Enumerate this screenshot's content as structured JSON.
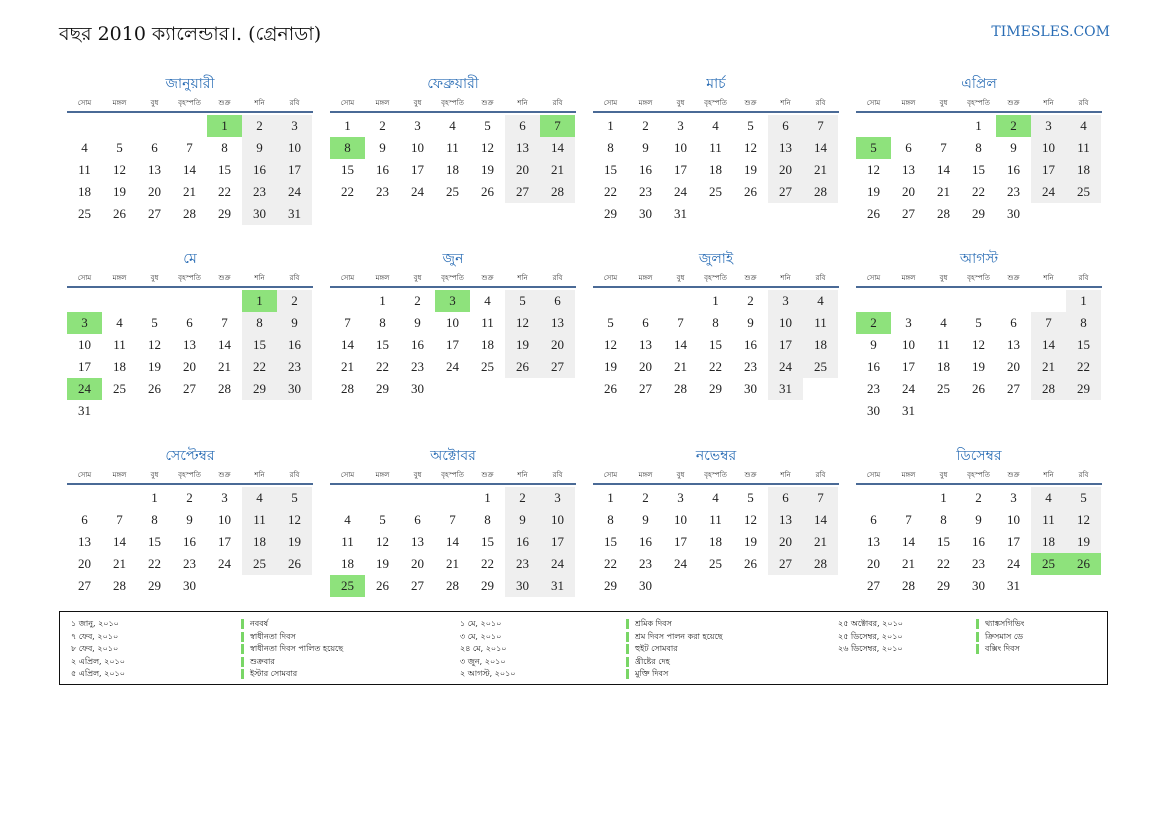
{
  "header": {
    "title": "বছর 2010 ক্যালেন্ডার।. (গ্রেনাডা)",
    "site": "TIMESLES.COM"
  },
  "weekdays": [
    "সোম",
    "মঙ্গল",
    "বুধ",
    "বৃহস্পতি",
    "শুক্র",
    "শনি",
    "রবি"
  ],
  "months": [
    {
      "name": "জানুয়ারী",
      "offset": 4,
      "days": 31,
      "holidays": [
        1
      ]
    },
    {
      "name": "ফেব্রুয়ারী",
      "offset": 0,
      "days": 28,
      "holidays": [
        7,
        8
      ]
    },
    {
      "name": "মার্চ",
      "offset": 0,
      "days": 31,
      "holidays": []
    },
    {
      "name": "এপ্রিল",
      "offset": 3,
      "days": 30,
      "holidays": [
        2,
        5
      ]
    },
    {
      "name": "মে",
      "offset": 5,
      "days": 31,
      "holidays": [
        1,
        3,
        24
      ]
    },
    {
      "name": "জুন",
      "offset": 1,
      "days": 30,
      "holidays": [
        3
      ]
    },
    {
      "name": "জুলাই",
      "offset": 3,
      "days": 31,
      "holidays": []
    },
    {
      "name": "আগস্ট",
      "offset": 6,
      "days": 31,
      "holidays": [
        2
      ]
    },
    {
      "name": "সেপ্টেম্বর",
      "offset": 2,
      "days": 30,
      "holidays": []
    },
    {
      "name": "অক্টোবর",
      "offset": 4,
      "days": 31,
      "holidays": [
        25
      ]
    },
    {
      "name": "নভেম্বর",
      "offset": 0,
      "days": 30,
      "holidays": []
    },
    {
      "name": "ডিসেম্বর",
      "offset": 2,
      "days": 31,
      "holidays": [
        25,
        26
      ]
    }
  ],
  "holidays": [
    {
      "date": "১ জানু, ২০১০",
      "name": "নববর্ষ"
    },
    {
      "date": "৭ ফেব, ২০১০",
      "name": "স্বাধীনতা দিবস"
    },
    {
      "date": "৮ ফেব, ২০১০",
      "name": "স্বাধীনতা দিবস পালিত হয়েছে"
    },
    {
      "date": "২ এপ্রিল, ২০১০",
      "name": "শুক্রবার"
    },
    {
      "date": "৫ এপ্রিল, ২০১০",
      "name": "ইস্টার সোমবার"
    },
    {
      "date": "১ মে, ২০১০",
      "name": "শ্রমিক দিবস"
    },
    {
      "date": "৩ মে, ২০১০",
      "name": "শ্রম দিবস পালন করা হয়েছে"
    },
    {
      "date": "২৪ মে, ২০১০",
      "name": "হুইট সোমবার"
    },
    {
      "date": "৩ জুন, ২০১০",
      "name": "খ্রীষ্টের দেহ"
    },
    {
      "date": "২ আগস্ট, ২০১০",
      "name": "মুক্তি দিবস"
    },
    {
      "date": "২৫ অক্টোবর, ২০১০",
      "name": "থ্যাঙ্কসগিভিং"
    },
    {
      "date": "২৫ ডিসেম্বর, ২০১০",
      "name": "ক্রিসমাস ডে"
    },
    {
      "date": "২৬ ডিসেম্বর, ২০১০",
      "name": "বক্সিং দিবস"
    }
  ],
  "colors": {
    "accent": "#2a6db5",
    "holiday": "#8ee27c",
    "weekend": "#efefef",
    "rule": "#4a6a96"
  }
}
